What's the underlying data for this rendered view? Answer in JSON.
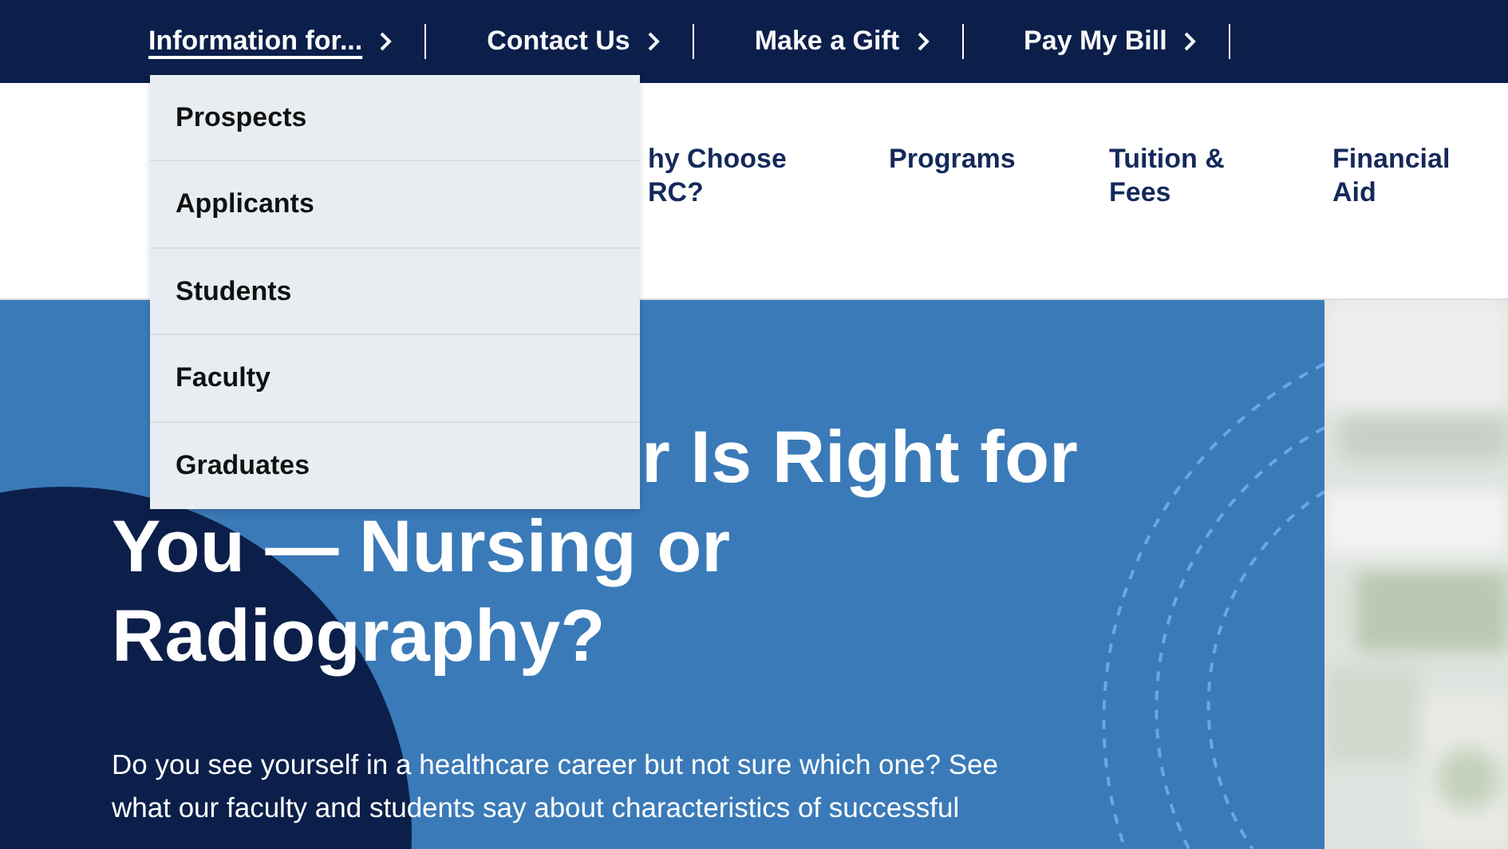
{
  "utility_nav": [
    {
      "label": "Information for...",
      "active": true
    },
    {
      "label": "Contact Us",
      "active": false
    },
    {
      "label": "Make a Gift",
      "active": false
    },
    {
      "label": "Pay My Bill",
      "active": false
    }
  ],
  "dropdown": {
    "items": [
      "Prospects",
      "Applicants",
      "Students",
      "Faculty",
      "Graduates"
    ]
  },
  "main_nav": [
    {
      "lines": [
        "hy Choose",
        "RC?"
      ]
    },
    {
      "lines": [
        "Programs"
      ]
    },
    {
      "lines": [
        "Tuition &",
        "Fees"
      ]
    },
    {
      "lines": [
        "Financial",
        "Aid"
      ]
    }
  ],
  "hero": {
    "heading_first_line": "r Is Right for",
    "heading_lines": [
      "You — Nursing or",
      "Radiography?"
    ],
    "paragraph_lines": [
      "Do you see yourself in a healthcare career but not sure which one? See",
      "what our faculty and students say about characteristics of successful"
    ]
  }
}
